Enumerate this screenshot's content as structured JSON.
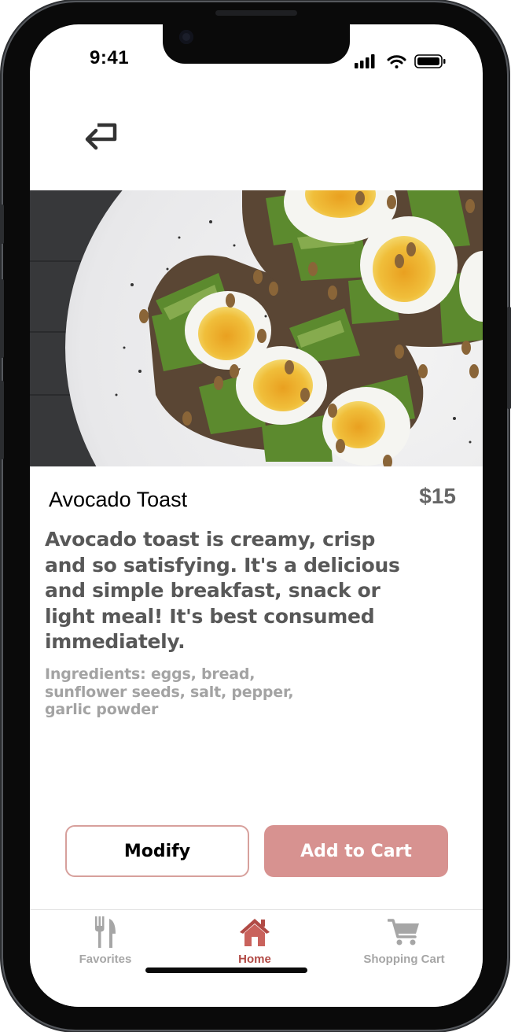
{
  "status_bar": {
    "time": "9:41"
  },
  "product": {
    "title": "Avocado Toast",
    "price": "$15",
    "description": "Avocado toast is creamy, crisp and so satisfying. It's a delicious and simple breakfast, snack or light meal! It's best consumed immediately.",
    "ingredients": "Ingredients: eggs, bread, sunflower seeds, salt, pepper, garlic powder"
  },
  "actions": {
    "modify_label": "Modify",
    "add_to_cart_label": "Add to Cart"
  },
  "tabs": [
    {
      "label": "Favorites",
      "icon": "fork-knife-icon"
    },
    {
      "label": "Home",
      "icon": "home-icon",
      "active": true
    },
    {
      "label": "Shopping Cart",
      "icon": "cart-icon"
    }
  ],
  "colors": {
    "accent": "#d79290",
    "active_tab": "#b14a45",
    "modify_border": "#d7a09c"
  }
}
